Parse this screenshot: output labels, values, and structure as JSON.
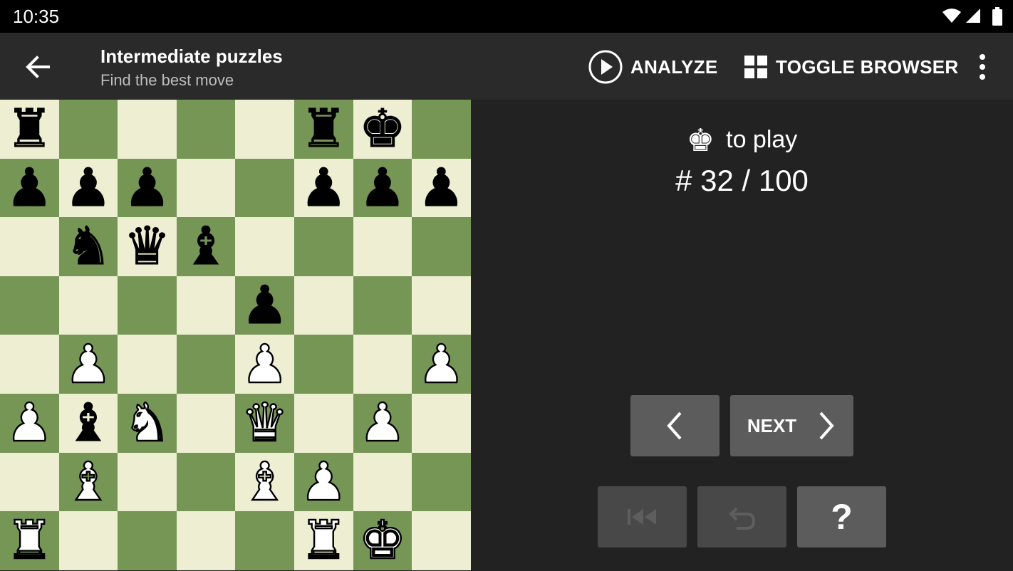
{
  "status_bar": {
    "time": "10:35"
  },
  "app_bar": {
    "title": "Intermediate puzzles",
    "subtitle": "Find the best move",
    "analyze_label": "ANALYZE",
    "toggle_browser_label": "TOGGLE BROWSER"
  },
  "puzzle": {
    "to_play_label": "to play",
    "side_to_move": "black",
    "counter": "# 32 / 100"
  },
  "controls": {
    "next_label": "NEXT",
    "hint_label": "?"
  },
  "colors": {
    "light_square": "#eeeed2",
    "dark_square": "#769656",
    "panel_bg": "#222222",
    "appbar_bg": "#2a2a2a",
    "button_bg": "#5c5c5c",
    "button_disabled_bg": "#484848"
  },
  "board": [
    [
      "r",
      "",
      "",
      "",
      "",
      "r",
      "k",
      ""
    ],
    [
      "p",
      "p",
      "p",
      "",
      "",
      "p",
      "p",
      "p"
    ],
    [
      "",
      "n",
      "q",
      "b",
      "",
      "",
      "",
      ""
    ],
    [
      "",
      "",
      "",
      "",
      "p",
      "",
      "",
      ""
    ],
    [
      "",
      "P",
      "",
      "",
      "P",
      "",
      "",
      "P"
    ],
    [
      "P",
      "b",
      "N",
      "",
      "Q",
      "",
      "P",
      ""
    ],
    [
      "",
      "B",
      "",
      "",
      "B",
      "P",
      "",
      ""
    ],
    [
      "R",
      "",
      "",
      "",
      "",
      "R",
      "K",
      ""
    ]
  ],
  "icons": {
    "back": "arrow-left-icon",
    "analyze": "play-circle-icon",
    "toggle_browser": "grid-icon",
    "overflow": "more-vert-icon",
    "prev": "chevron-left-icon",
    "next": "chevron-right-icon",
    "first": "skip-first-icon",
    "undo": "undo-icon"
  }
}
